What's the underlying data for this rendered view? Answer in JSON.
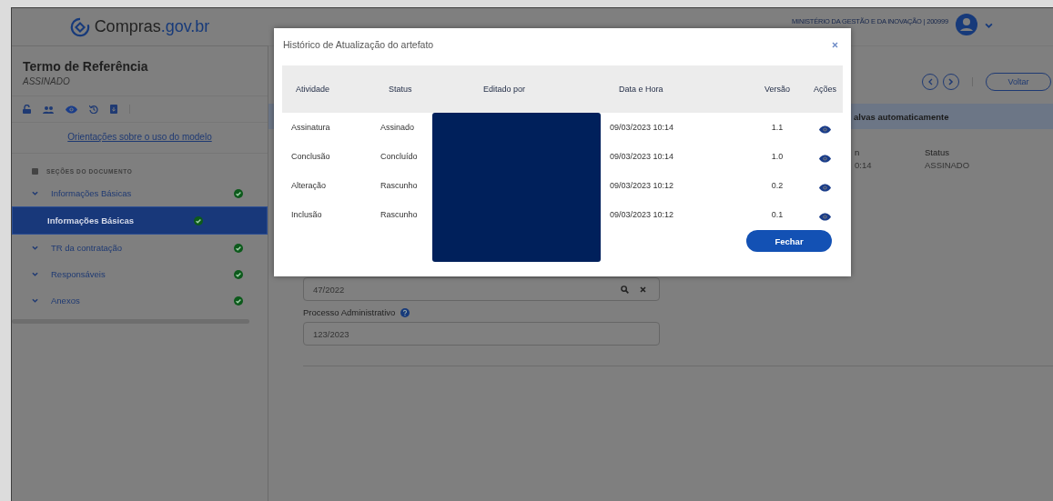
{
  "header": {
    "logo": {
      "name": "Compras",
      "suffix": ".gov.br"
    },
    "organization": "MINISTÉRIO DA GESTÃO E DA INOVAÇÃO | 200999"
  },
  "sidebar": {
    "title": "Termo de Referência",
    "status": "ASSINADO",
    "guide_link": "Orientações sobre o uso do modelo",
    "sections_heading": "SEÇÕES DO DOCUMENTO",
    "items": [
      {
        "label": "Informações Básicas",
        "selected": false,
        "done": true,
        "children": [
          {
            "label": "Informações Básicas",
            "selected": true,
            "done": true
          }
        ]
      },
      {
        "label": "TR da contratação",
        "selected": false,
        "done": true
      },
      {
        "label": "Responsáveis",
        "selected": false,
        "done": true
      },
      {
        "label": "Anexos",
        "selected": false,
        "done": true
      }
    ]
  },
  "toolbar": {
    "back_button": "Voltar"
  },
  "banner": "alvas automaticamente",
  "meta": [
    {
      "label": "n",
      "value": "0:14"
    },
    {
      "label": "Status",
      "value": "ASSINADO"
    }
  ],
  "form": {
    "fields": [
      {
        "kind": "search",
        "value": "47/2022"
      },
      {
        "kind": "text",
        "label": "Processo Administrativo",
        "value": "123/2023"
      }
    ]
  },
  "modal": {
    "title": "Histórico de Atualização do artefato",
    "columns": [
      "Atividade",
      "Status",
      "Editado por",
      "Data e Hora",
      "Versão",
      "Ações"
    ],
    "rows": [
      {
        "activity": "Assinatura",
        "status": "Assinado",
        "datetime": "09/03/2023 10:14",
        "version": "1.1"
      },
      {
        "activity": "Conclusão",
        "status": "Concluído",
        "datetime": "09/03/2023 10:14",
        "version": "1.0"
      },
      {
        "activity": "Alteração",
        "status": "Rascunho",
        "datetime": "09/03/2023 10:12",
        "version": "0.2"
      },
      {
        "activity": "Inclusão",
        "status": "Rascunho",
        "datetime": "09/03/2023 10:12",
        "version": "0.1"
      }
    ],
    "close_button": "Fechar"
  }
}
